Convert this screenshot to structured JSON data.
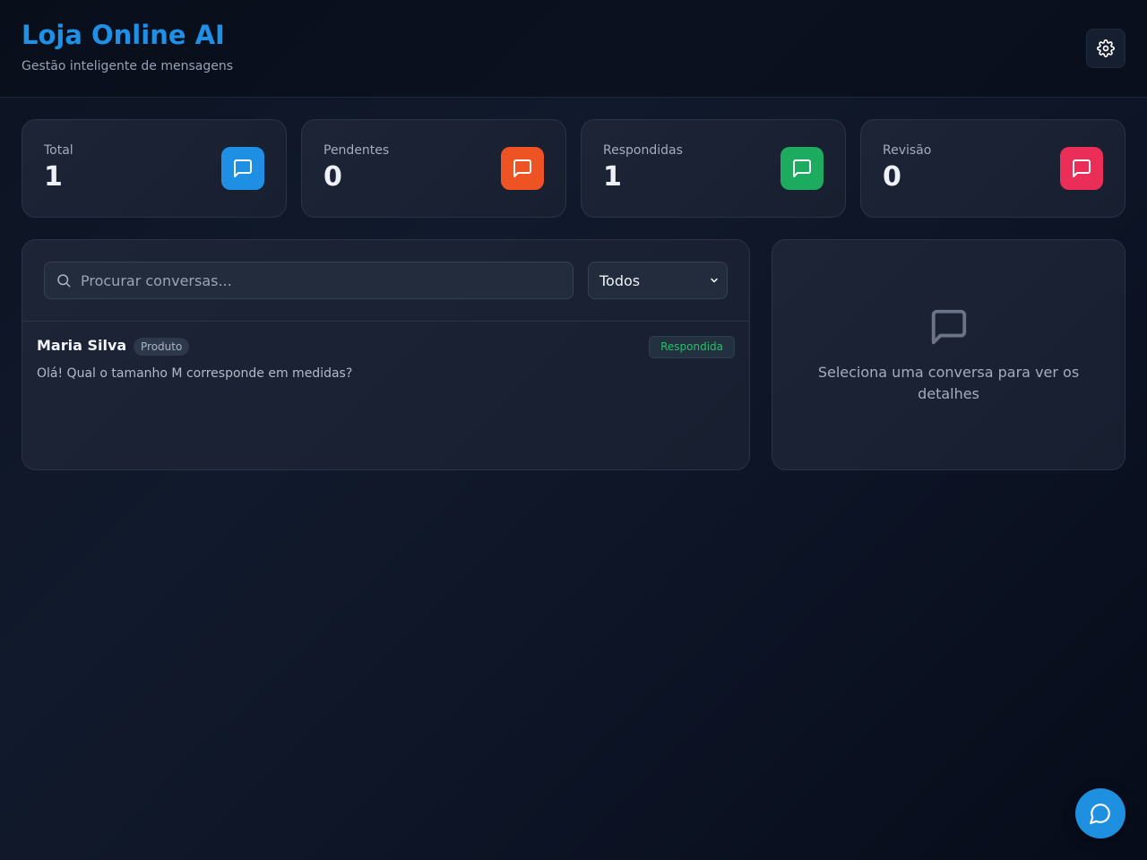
{
  "header": {
    "title": "Loja Online AI",
    "subtitle": "Gestão inteligente de mensagens",
    "settings_icon": "gear-icon"
  },
  "stats": [
    {
      "label": "Total",
      "value": "1",
      "color": "#1e8fe3",
      "icon": "message-square-icon"
    },
    {
      "label": "Pendentes",
      "value": "0",
      "color": "#ee5324",
      "icon": "message-square-icon"
    },
    {
      "label": "Respondidas",
      "value": "1",
      "color": "#1dac5f",
      "icon": "message-square-icon"
    },
    {
      "label": "Revisão",
      "value": "0",
      "color": "#ea2e57",
      "icon": "message-square-icon"
    }
  ],
  "search": {
    "placeholder": "Procurar conversas...",
    "value": ""
  },
  "filter": {
    "selected": "Todos"
  },
  "conversations": [
    {
      "name": "Maria Silva",
      "tag": "Produto",
      "status": "Respondida",
      "status_color": "#22c366",
      "preview": "Olá! Qual o tamanho M corresponde em medidas?"
    }
  ],
  "detail": {
    "empty_text": "Seleciona uma conversa para ver os detalhes"
  },
  "fab": {
    "icon": "chat-bubble-icon",
    "color": "#1f8fe0"
  }
}
